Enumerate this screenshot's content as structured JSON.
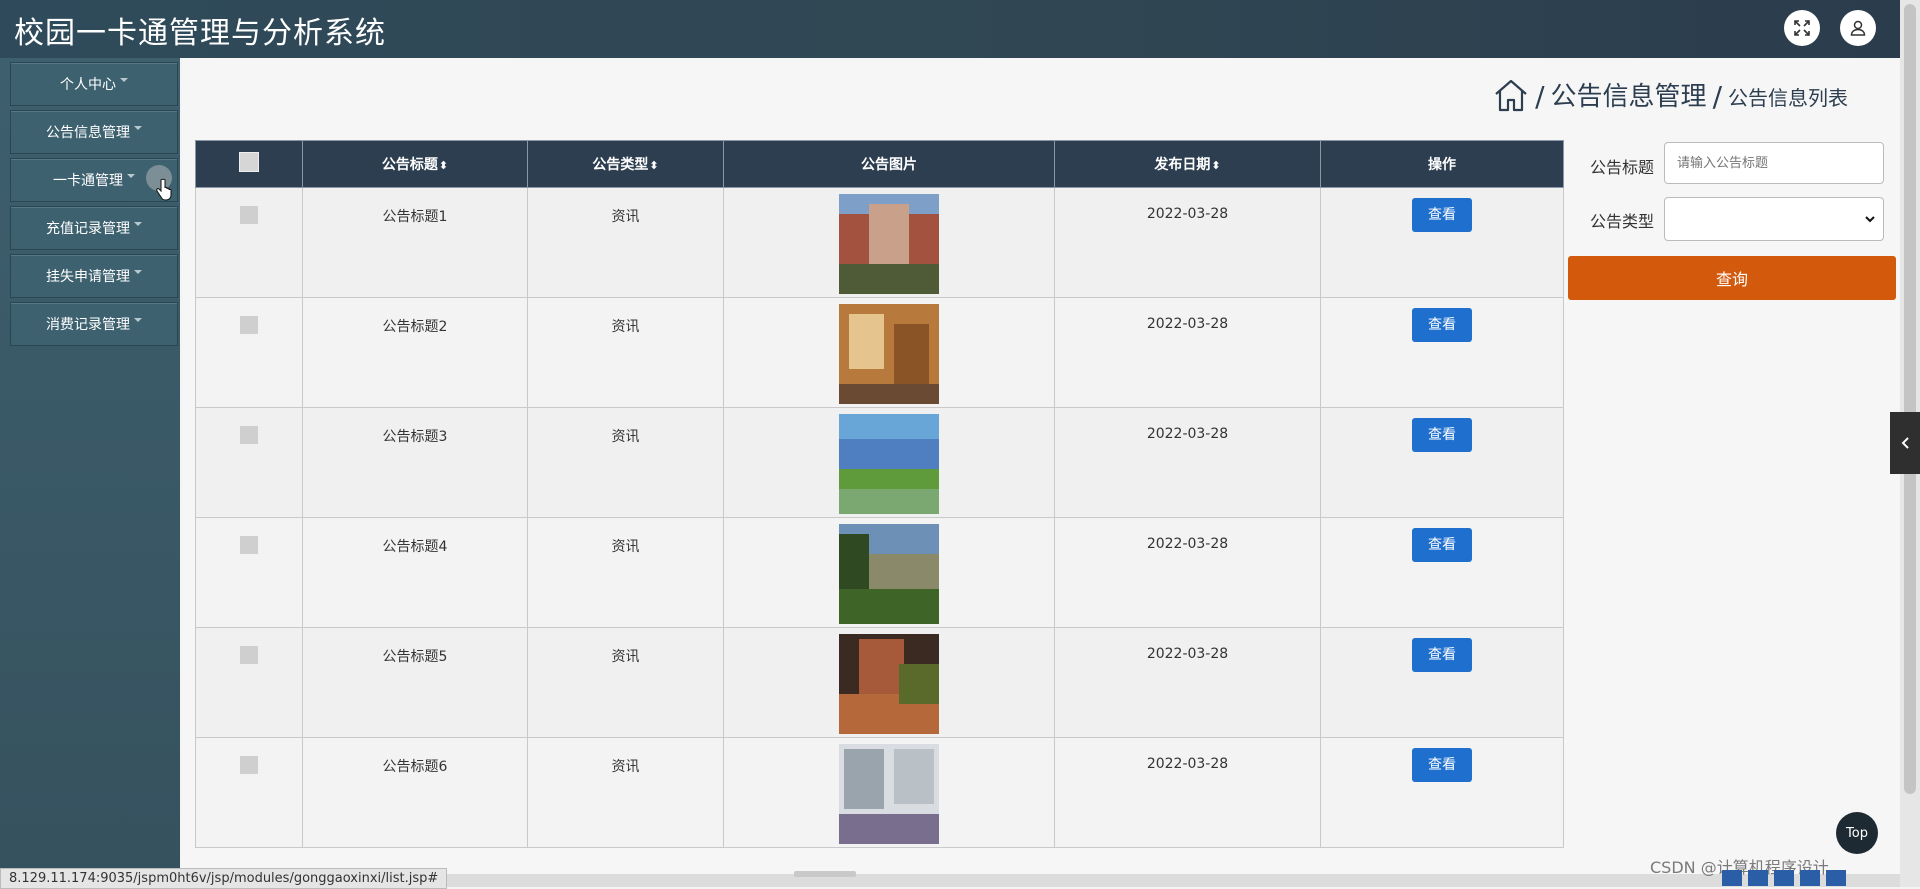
{
  "header": {
    "title": "校园一卡通管理与分析系统",
    "icons": [
      "fullscreen-icon",
      "user-icon"
    ]
  },
  "sidebar": {
    "items": [
      {
        "label": "个人中心"
      },
      {
        "label": "公告信息管理"
      },
      {
        "label": "一卡通管理"
      },
      {
        "label": "充值记录管理"
      },
      {
        "label": "挂失申请管理"
      },
      {
        "label": "消费记录管理"
      }
    ]
  },
  "breadcrumb": {
    "section": "公告信息管理",
    "page": "公告信息列表",
    "separator": "/"
  },
  "table": {
    "columns": [
      {
        "label": "",
        "sortable": false
      },
      {
        "label": "公告标题",
        "sortable": true
      },
      {
        "label": "公告类型",
        "sortable": true
      },
      {
        "label": "公告图片",
        "sortable": false
      },
      {
        "label": "发布日期",
        "sortable": true
      },
      {
        "label": "操作",
        "sortable": false
      }
    ],
    "rows": [
      {
        "title": "公告标题1",
        "type": "资讯",
        "date": "2022-03-28",
        "action": "查看"
      },
      {
        "title": "公告标题2",
        "type": "资讯",
        "date": "2022-03-28",
        "action": "查看"
      },
      {
        "title": "公告标题3",
        "type": "资讯",
        "date": "2022-03-28",
        "action": "查看"
      },
      {
        "title": "公告标题4",
        "type": "资讯",
        "date": "2022-03-28",
        "action": "查看"
      },
      {
        "title": "公告标题5",
        "type": "资讯",
        "date": "2022-03-28",
        "action": "查看"
      },
      {
        "title": "公告标题6",
        "type": "资讯",
        "date": "2022-03-28",
        "action": "查看"
      }
    ]
  },
  "search": {
    "title_label": "公告标题",
    "title_placeholder": "请输入公告标题",
    "type_label": "公告类型",
    "type_value": "",
    "submit_label": "查询"
  },
  "top_button": "Top",
  "status_url": "8.129.11.174:9035/jspm0ht6v/jsp/modules/gonggaoxinxi/list.jsp#",
  "watermark": "CSDN @计算机程序设计",
  "colors": {
    "header_bg": "#2f4a5a",
    "sidebar_bg": "#3d5f6e",
    "table_header_bg": "#2c3e50",
    "view_button": "#1f6fcf",
    "query_button": "#d35a0d"
  }
}
